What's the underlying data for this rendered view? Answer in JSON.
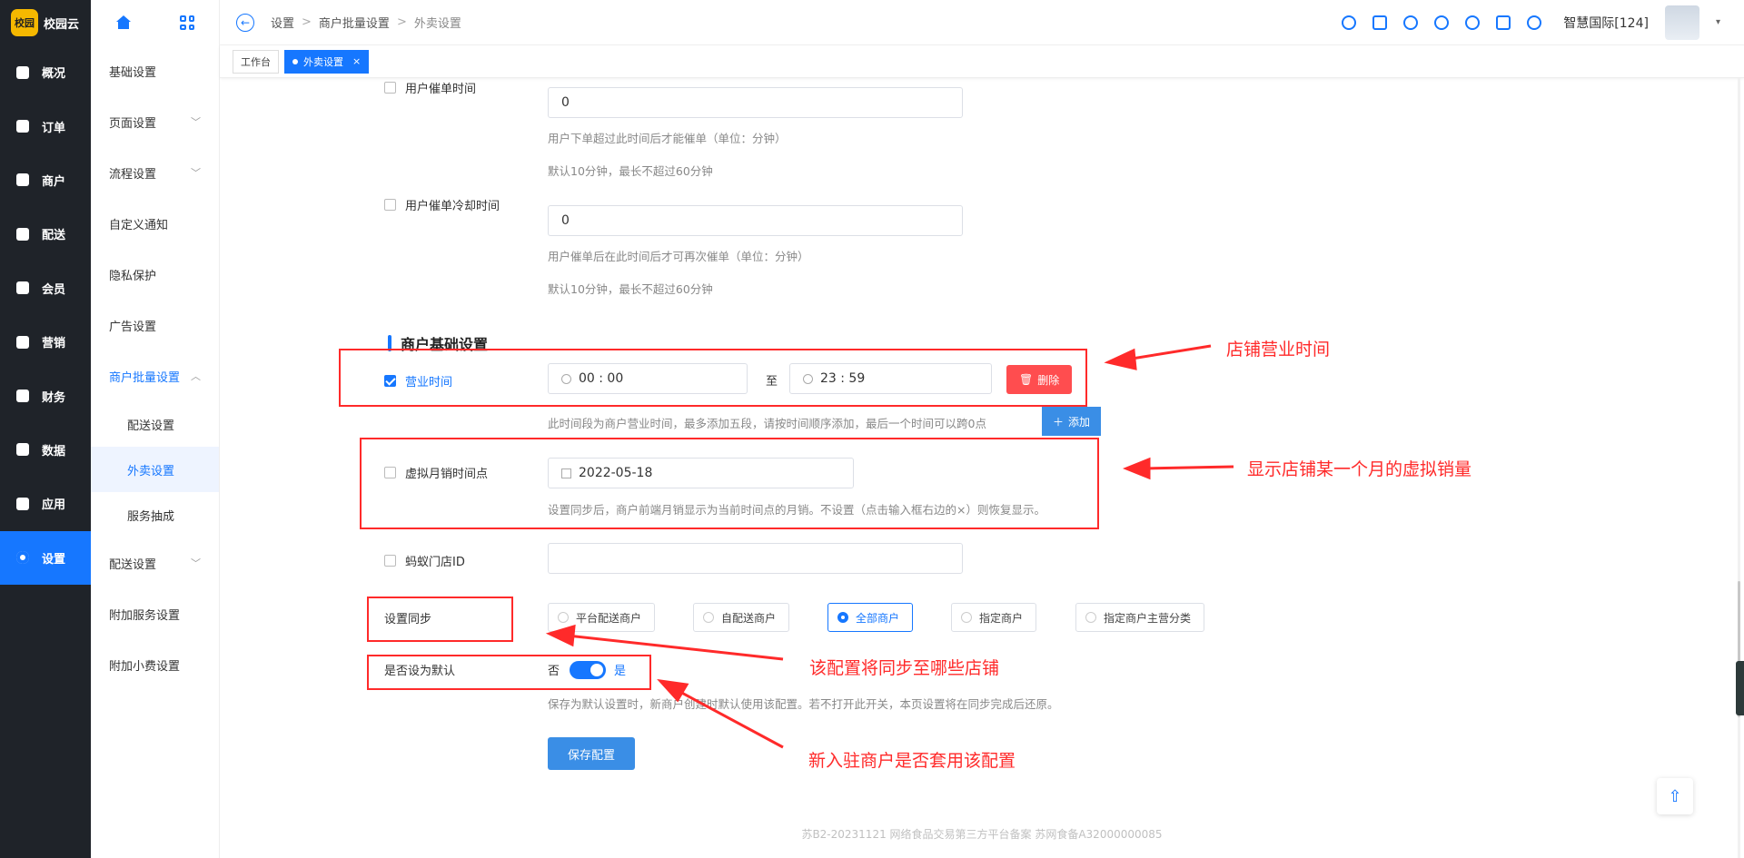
{
  "app": {
    "logo_badge": "校园",
    "logo_text": "校园云"
  },
  "main_nav": [
    {
      "label": "概况",
      "icon": "overview-icon"
    },
    {
      "label": "订单",
      "icon": "order-icon"
    },
    {
      "label": "商户",
      "icon": "merchant-icon"
    },
    {
      "label": "配送",
      "icon": "delivery-icon"
    },
    {
      "label": "会员",
      "icon": "member-icon"
    },
    {
      "label": "营销",
      "icon": "marketing-icon"
    },
    {
      "label": "财务",
      "icon": "finance-icon"
    },
    {
      "label": "数据",
      "icon": "data-icon"
    },
    {
      "label": "应用",
      "icon": "app-icon"
    },
    {
      "label": "设置",
      "icon": "settings-icon",
      "active": true
    }
  ],
  "sub_nav": {
    "items": [
      {
        "label": "基础设置"
      },
      {
        "label": "页面设置",
        "chevron": "﹀"
      },
      {
        "label": "流程设置",
        "chevron": "﹀"
      },
      {
        "label": "自定义通知"
      },
      {
        "label": "隐私保护"
      },
      {
        "label": "广告设置"
      },
      {
        "label": "商户批量设置",
        "chevron": "︿"
      }
    ],
    "children": [
      {
        "label": "配送设置"
      },
      {
        "label": "外卖设置",
        "active": true
      },
      {
        "label": "服务抽成"
      }
    ],
    "items_after": [
      {
        "label": "配送设置",
        "chevron": "﹀"
      },
      {
        "label": "附加服务设置"
      },
      {
        "label": "附加小费设置"
      }
    ]
  },
  "header": {
    "back_icon": "←",
    "breadcrumb": [
      "设置",
      "商户批量设置",
      "外卖设置"
    ],
    "separator": ">",
    "user_name": "智慧国际[124]",
    "caret": "▾",
    "icons": [
      "search-icon",
      "fullscreen-icon",
      "refresh-icon",
      "download-icon",
      "eye-icon",
      "monitor-icon",
      "help-icon"
    ]
  },
  "tabs": {
    "workbench": "工作台",
    "active": "外卖设置",
    "close": "×"
  },
  "form": {
    "urge_time": {
      "label": "用户催单时间",
      "value": "0",
      "help1": "用户下单超过此时间后才能催单（单位：分钟）",
      "help2": "默认10分钟，最长不超过60分钟"
    },
    "urge_cooldown": {
      "label": "用户催单冷却时间",
      "value": "0",
      "help1": "用户催单后在此时间后才可再次催单（单位：分钟）",
      "help2": "默认10分钟，最长不超过60分钟"
    },
    "section_title": "商户基础设置",
    "business_hours": {
      "label": "营业时间",
      "start": "00 : 00",
      "to": "至",
      "end": "23 : 59",
      "delete": "删除",
      "help": "此时间段为商户营业时间，最多添加五段，请按时间顺序添加，最后一个时间可以跨0点",
      "add": "添加"
    },
    "virtual_sales": {
      "label": "虚拟月销时间点",
      "value": "2022-05-18",
      "help": "设置同步后，商户前端月销显示为当前时间点的月销。不设置（点击输入框右边的×）则恢复显示。"
    },
    "ant_store": {
      "label": "蚂蚁门店ID",
      "value": ""
    },
    "sync": {
      "label": "设置同步",
      "options": [
        "平台配送商户",
        "自配送商户",
        "全部商户",
        "指定商户",
        "指定商户主营分类"
      ],
      "selected_index": 2
    },
    "default": {
      "label": "是否设为默认",
      "off": "否",
      "on": "是",
      "enabled": true,
      "help": "保存为默认设置时，新商户创建时默认使用该配置。若不打开此开关，本页设置将在同步完成后还原。"
    },
    "save": "保存配置"
  },
  "annotations": {
    "note1": "店铺营业时间",
    "note2": "显示店铺某一个月的虚拟销量",
    "note3": "该配置将同步至哪些店铺",
    "note4": "新入驻商户是否套用该配置",
    "color": "#ff2a2a"
  },
  "footer": "苏B2-20231121   网络食品交易第三方平台备案 苏网食备A32000000085",
  "colors": {
    "primary": "#1677ff",
    "danger": "#ff4d4f",
    "sidebar": "#1f2329"
  }
}
